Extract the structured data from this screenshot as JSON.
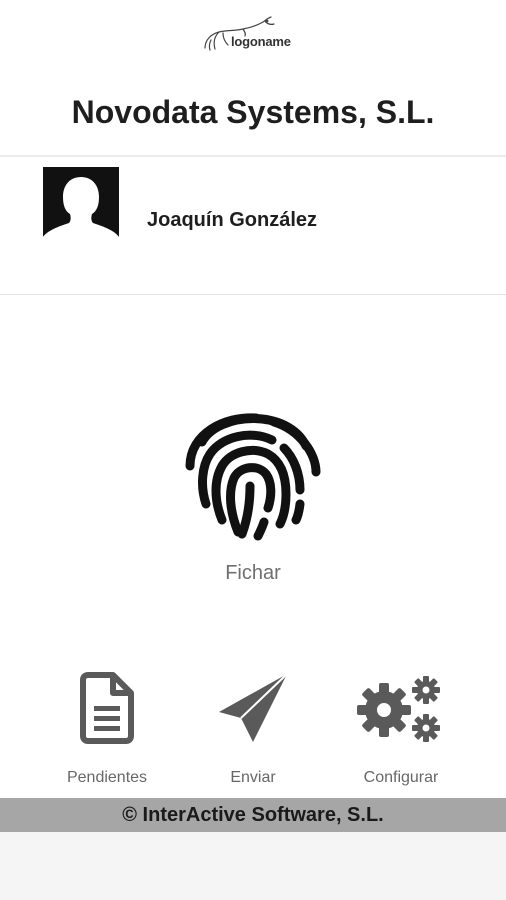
{
  "logo": {
    "text": "logoname",
    "icon": "animal-logo-icon"
  },
  "company": {
    "name": "Novodata Systems, S.L."
  },
  "user": {
    "name": "Joaquín González",
    "avatar_icon": "person-silhouette-icon"
  },
  "punch": {
    "label": "Fichar",
    "icon": "fingerprint-icon"
  },
  "actions": [
    {
      "label": "Pendientes",
      "icon": "document-icon"
    },
    {
      "label": "Enviar",
      "icon": "paper-plane-icon"
    },
    {
      "label": "Configurar",
      "icon": "gears-icon"
    }
  ],
  "footer": {
    "copyright": "© InterActive Software, S.L."
  },
  "colors": {
    "icon": "#5a5a5a",
    "footer_bar": "#a6a6a6",
    "label": "#676767"
  }
}
